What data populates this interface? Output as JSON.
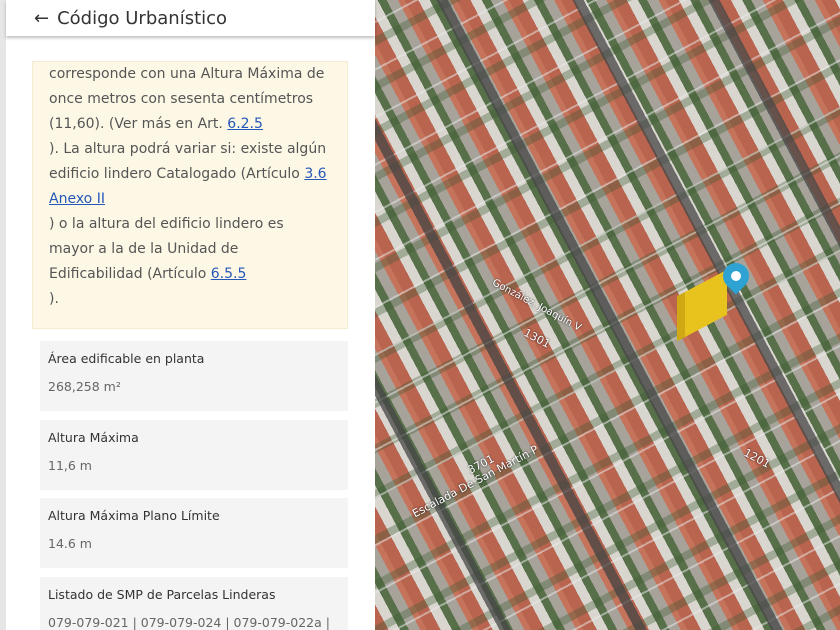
{
  "header": {
    "back_icon": "arrow-left-icon",
    "back_glyph": "←",
    "title": "Código Urbanístico"
  },
  "note": {
    "t1": "corresponde con una Altura Máxima de once metros con sesenta centímetros (11,60). (Ver más en Art. ",
    "l1": "6.2.5",
    "t2": "). La altura podrá variar si: existe algún edificio lindero Catalogado (Artículo ",
    "l2": "3.6 Anexo II",
    "t3": ") o la altura del edificio lindero es mayor a la de la Unidad de Edificabilidad (Artículo ",
    "l3": "6.5.5",
    "t4": ")."
  },
  "cards": [
    {
      "label": "Área edificable en planta",
      "value": "268,258 m²"
    },
    {
      "label": "Altura Máxima",
      "value": "11,6 m"
    },
    {
      "label": "Altura Máxima Plano Límite",
      "value": "14.6 m"
    },
    {
      "label": "Listado de SMP de Parcelas Linderas",
      "value": "079-079-021 | 079-079-024 | 079-079-022a |"
    }
  ],
  "map": {
    "streets": [
      "Escalada De San Martín P",
      "3701",
      "1201",
      "1301",
      "González, Joaquín V"
    ]
  }
}
